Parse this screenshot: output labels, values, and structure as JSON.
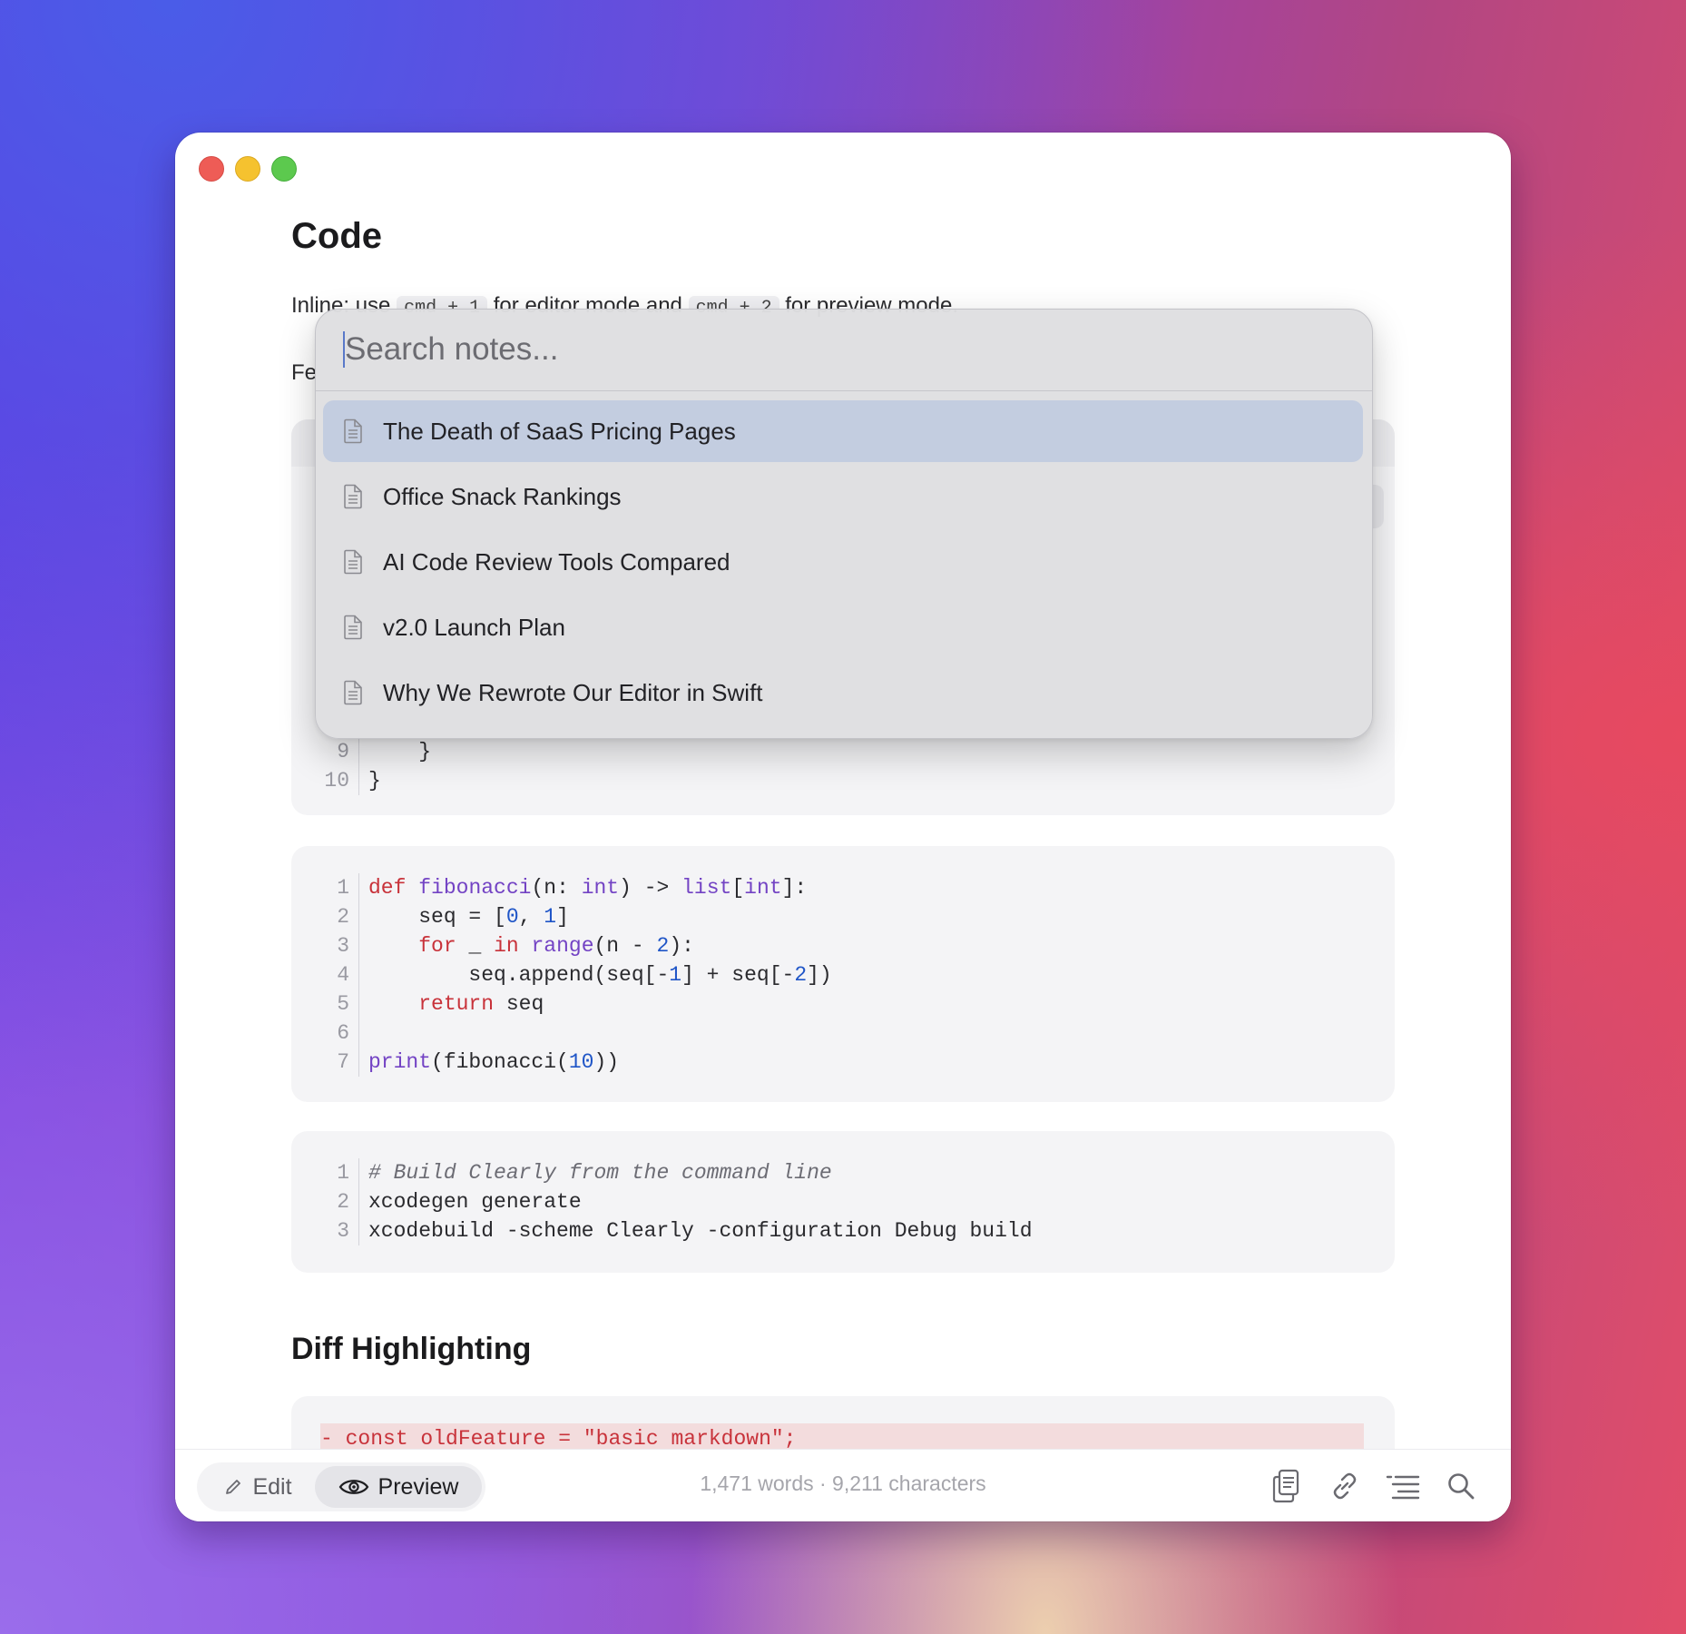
{
  "window": {
    "traffic_lights": [
      "close",
      "minimize",
      "zoom"
    ]
  },
  "document": {
    "title": "Code",
    "inline_para": {
      "before": "Inline: use",
      "code1": "cmd + 1",
      "middle": "for editor mode and",
      "code2": "cmd + 2",
      "after": "for preview mode."
    },
    "partial_para": "Fe",
    "code_block_1": {
      "lines": [
        {
          "n": "9",
          "text": "    }"
        },
        {
          "n": "10",
          "text": "}"
        }
      ]
    },
    "code_block_2": {
      "lines": [
        {
          "n": "1",
          "tokens": [
            [
              "def",
              "kw-red"
            ],
            [
              " ",
              ""
            ],
            [
              "fibonacci",
              "kw-purple"
            ],
            [
              "(n: ",
              ""
            ],
            [
              "int",
              "kw-purple"
            ],
            [
              ") -> ",
              ""
            ],
            [
              "list",
              "kw-purple"
            ],
            [
              "[",
              ""
            ],
            [
              "int",
              "kw-purple"
            ],
            [
              "]:",
              ""
            ]
          ]
        },
        {
          "n": "2",
          "tokens": [
            [
              "    seq = [",
              ""
            ],
            [
              "0",
              "num-blue"
            ],
            [
              ", ",
              ""
            ],
            [
              "1",
              "num-blue"
            ],
            [
              "]",
              ""
            ]
          ]
        },
        {
          "n": "3",
          "tokens": [
            [
              "    ",
              ""
            ],
            [
              "for",
              "kw-red"
            ],
            [
              " _ ",
              ""
            ],
            [
              "in",
              "kw-red"
            ],
            [
              " ",
              ""
            ],
            [
              "range",
              "kw-purple"
            ],
            [
              "(n - ",
              ""
            ],
            [
              "2",
              "num-blue"
            ],
            [
              "):",
              ""
            ]
          ]
        },
        {
          "n": "4",
          "tokens": [
            [
              "        seq.append(seq[-",
              ""
            ],
            [
              "1",
              "num-blue"
            ],
            [
              "] + seq[-",
              ""
            ],
            [
              "2",
              "num-blue"
            ],
            [
              "])",
              ""
            ]
          ]
        },
        {
          "n": "5",
          "tokens": [
            [
              "    ",
              ""
            ],
            [
              "return",
              "kw-red"
            ],
            [
              " seq",
              ""
            ]
          ]
        },
        {
          "n": "6",
          "tokens": [
            [
              "",
              ""
            ]
          ]
        },
        {
          "n": "7",
          "tokens": [
            [
              "print",
              "kw-purple"
            ],
            [
              "(fibonacci(",
              ""
            ],
            [
              "10",
              "num-blue"
            ],
            [
              "))",
              ""
            ]
          ]
        }
      ]
    },
    "code_block_3": {
      "lines": [
        {
          "n": "1",
          "tokens": [
            [
              "# Build Clearly from the command line",
              "comment"
            ]
          ]
        },
        {
          "n": "2",
          "tokens": [
            [
              "xcodegen generate",
              ""
            ]
          ]
        },
        {
          "n": "3",
          "tokens": [
            [
              "xcodebuild -scheme Clearly -configuration Debug build",
              ""
            ]
          ]
        }
      ]
    },
    "diff_heading": "Diff Highlighting",
    "diff_line": "- const oldFeature = \"basic markdown\";"
  },
  "toolbar": {
    "edit_label": "Edit",
    "preview_label": "Preview",
    "stats": "1,471 words · 9,211 characters",
    "icons": [
      "copy-icon",
      "link-icon",
      "outline-icon",
      "search-icon"
    ]
  },
  "search": {
    "placeholder": "Search notes...",
    "value": "",
    "results": [
      {
        "label": "The Death of SaaS Pricing Pages",
        "selected": true
      },
      {
        "label": "Office Snack Rankings",
        "selected": false
      },
      {
        "label": "AI Code Review Tools Compared",
        "selected": false
      },
      {
        "label": "v2.0 Launch Plan",
        "selected": false
      },
      {
        "label": "Why We Rewrote Our Editor in Swift",
        "selected": false
      }
    ]
  },
  "colors": {
    "accent": "#5a79c9",
    "selected_row": "#c3cde0",
    "keyword": "#c8323a",
    "builtin": "#7343c4",
    "number": "#1f55c7"
  }
}
